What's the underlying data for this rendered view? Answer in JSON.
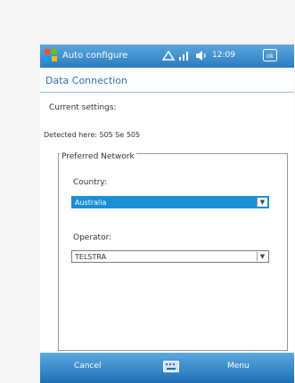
{
  "titlebar": {
    "app_title": "Auto configure",
    "time": "12:09",
    "ok_label": "ok"
  },
  "page": {
    "heading": "Data Connection",
    "current_settings_label": "Current settings:",
    "detected": "Detected here: 505   Se 505"
  },
  "preferred_network": {
    "legend": "Preferred Network",
    "country_label": "Country:",
    "country_value": "Australia",
    "operator_label": "Operator:",
    "operator_value": "TELSTRA"
  },
  "softkeys": {
    "left": "Cancel",
    "right": "Menu"
  },
  "colors": {
    "titlebar": "#2b7cc0",
    "heading": "#2a6db5",
    "selection": "#1a8fd6"
  },
  "icons": [
    "windows-logo-icon",
    "connectivity-icon",
    "signal-icon",
    "volume-icon",
    "ok-icon",
    "chevron-down-icon",
    "keyboard-icon"
  ]
}
